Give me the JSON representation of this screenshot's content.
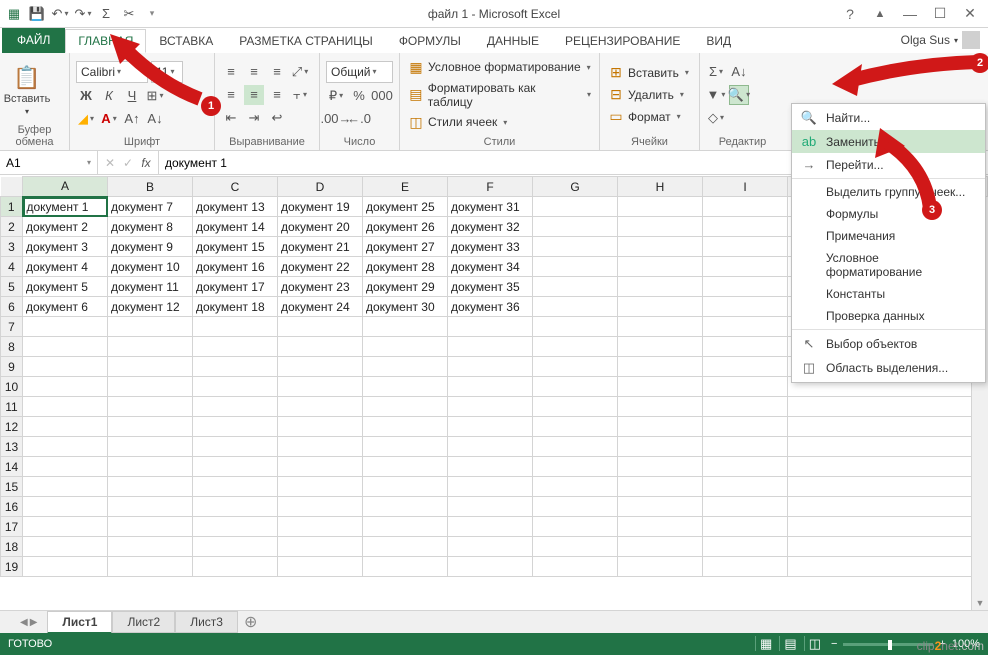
{
  "titlebar": {
    "title": "файл 1 - Microsoft Excel"
  },
  "tabs": {
    "file": "ФАЙЛ",
    "items": [
      "ГЛАВНАЯ",
      "ВСТАВКА",
      "РАЗМЕТКА СТРАНИЦЫ",
      "ФОРМУЛЫ",
      "ДАННЫЕ",
      "РЕЦЕНЗИРОВАНИЕ",
      "ВИД"
    ],
    "active": 0,
    "user": "Olga Sus"
  },
  "ribbon": {
    "clipboard": {
      "paste": "Вставить",
      "label": "Буфер обмена"
    },
    "font": {
      "name": "Calibri",
      "size": "11",
      "label": "Шрифт"
    },
    "alignment": {
      "label": "Выравнивание"
    },
    "number": {
      "format": "Общий",
      "label": "Число"
    },
    "styles": {
      "conditional": "Условное форматирование",
      "table": "Форматировать как таблицу",
      "cell": "Стили ячеек",
      "label": "Стили"
    },
    "cells": {
      "insert": "Вставить",
      "delete": "Удалить",
      "format": "Формат",
      "label": "Ячейки"
    },
    "editing": {
      "label": "Редактир"
    }
  },
  "formula_bar": {
    "cell_ref": "A1",
    "formula": "документ 1"
  },
  "columns": [
    "A",
    "B",
    "C",
    "D",
    "E",
    "F",
    "G",
    "H",
    "I"
  ],
  "rows": [
    [
      "документ 1",
      "документ 7",
      "документ 13",
      "документ 19",
      "документ 25",
      "документ 31",
      "",
      "",
      ""
    ],
    [
      "документ 2",
      "документ 8",
      "документ 14",
      "документ 20",
      "документ 26",
      "документ 32",
      "",
      "",
      ""
    ],
    [
      "документ 3",
      "документ 9",
      "документ 15",
      "документ 21",
      "документ 27",
      "документ 33",
      "",
      "",
      ""
    ],
    [
      "документ 4",
      "документ 10",
      "документ 16",
      "документ 22",
      "документ 28",
      "документ 34",
      "",
      "",
      ""
    ],
    [
      "документ 5",
      "документ 11",
      "документ 17",
      "документ 23",
      "документ 29",
      "документ 35",
      "",
      "",
      ""
    ],
    [
      "документ 6",
      "документ 12",
      "документ 18",
      "документ 24",
      "документ 30",
      "документ 36",
      "",
      "",
      ""
    ]
  ],
  "total_rows": 19,
  "find_menu": {
    "find": "Найти...",
    "replace": "Заменить...",
    "goto": "Перейти...",
    "goto_special": "Выделить группу ячеек...",
    "formulas": "Формулы",
    "comments": "Примечания",
    "cond_fmt": "Условное форматирование",
    "constants": "Константы",
    "validation": "Проверка данных",
    "select_obj": "Выбор объектов",
    "selection_pane": "Область выделения..."
  },
  "sheets": {
    "items": [
      "Лист1",
      "Лист2",
      "Лист3"
    ],
    "active": 0
  },
  "status": {
    "ready": "ГОТОВО",
    "zoom": "100%"
  },
  "callouts": {
    "b1": "1",
    "b2": "2",
    "b3": "3"
  },
  "watermark": {
    "t1": "clip",
    "t2": "2",
    "t3": "net",
    "t4": ".com"
  }
}
